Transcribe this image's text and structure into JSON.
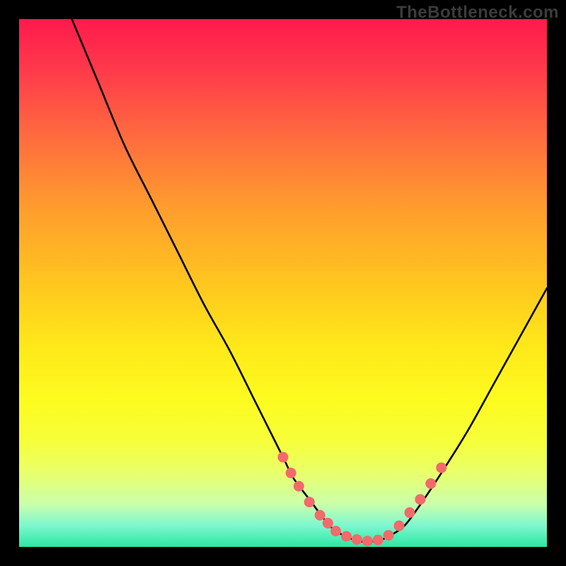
{
  "watermark": "TheBottleneck.com",
  "chart_data": {
    "type": "line",
    "title": "",
    "xlabel": "",
    "ylabel": "",
    "xlim": [
      0,
      100
    ],
    "ylim": [
      0,
      100
    ],
    "grid": false,
    "legend": false,
    "note": "y estimated from pixel position; 0 = bottom (green), 100 = top (red); curve shows bottleneck %, valley near 0 is optimal",
    "series": [
      {
        "name": "bottleneck-curve",
        "x": [
          10,
          15,
          20,
          25,
          30,
          35,
          40,
          45,
          50,
          52,
          55,
          58,
          60,
          63,
          65,
          68,
          70,
          73,
          76,
          80,
          85,
          90,
          95,
          100
        ],
        "y": [
          100,
          88,
          76,
          66,
          56,
          46,
          37,
          27,
          17,
          13,
          9,
          5,
          3,
          1.5,
          1,
          1.2,
          2,
          4,
          8,
          14,
          22,
          31,
          40,
          49
        ]
      }
    ],
    "markers": {
      "name": "sample-dots",
      "color": "#f26a6a",
      "x": [
        50,
        51.5,
        53,
        55,
        57,
        58.5,
        60,
        62,
        64,
        66,
        68,
        70,
        72,
        74,
        76,
        78,
        80
      ],
      "y": [
        17,
        14,
        11.5,
        8.5,
        6,
        4.5,
        3,
        2,
        1.4,
        1.1,
        1.3,
        2.2,
        4,
        6.5,
        9,
        12,
        15
      ]
    },
    "background_gradient": {
      "top": "#ff1a4d",
      "middle": "#ffe81a",
      "bottom": "#2be8a2"
    }
  }
}
